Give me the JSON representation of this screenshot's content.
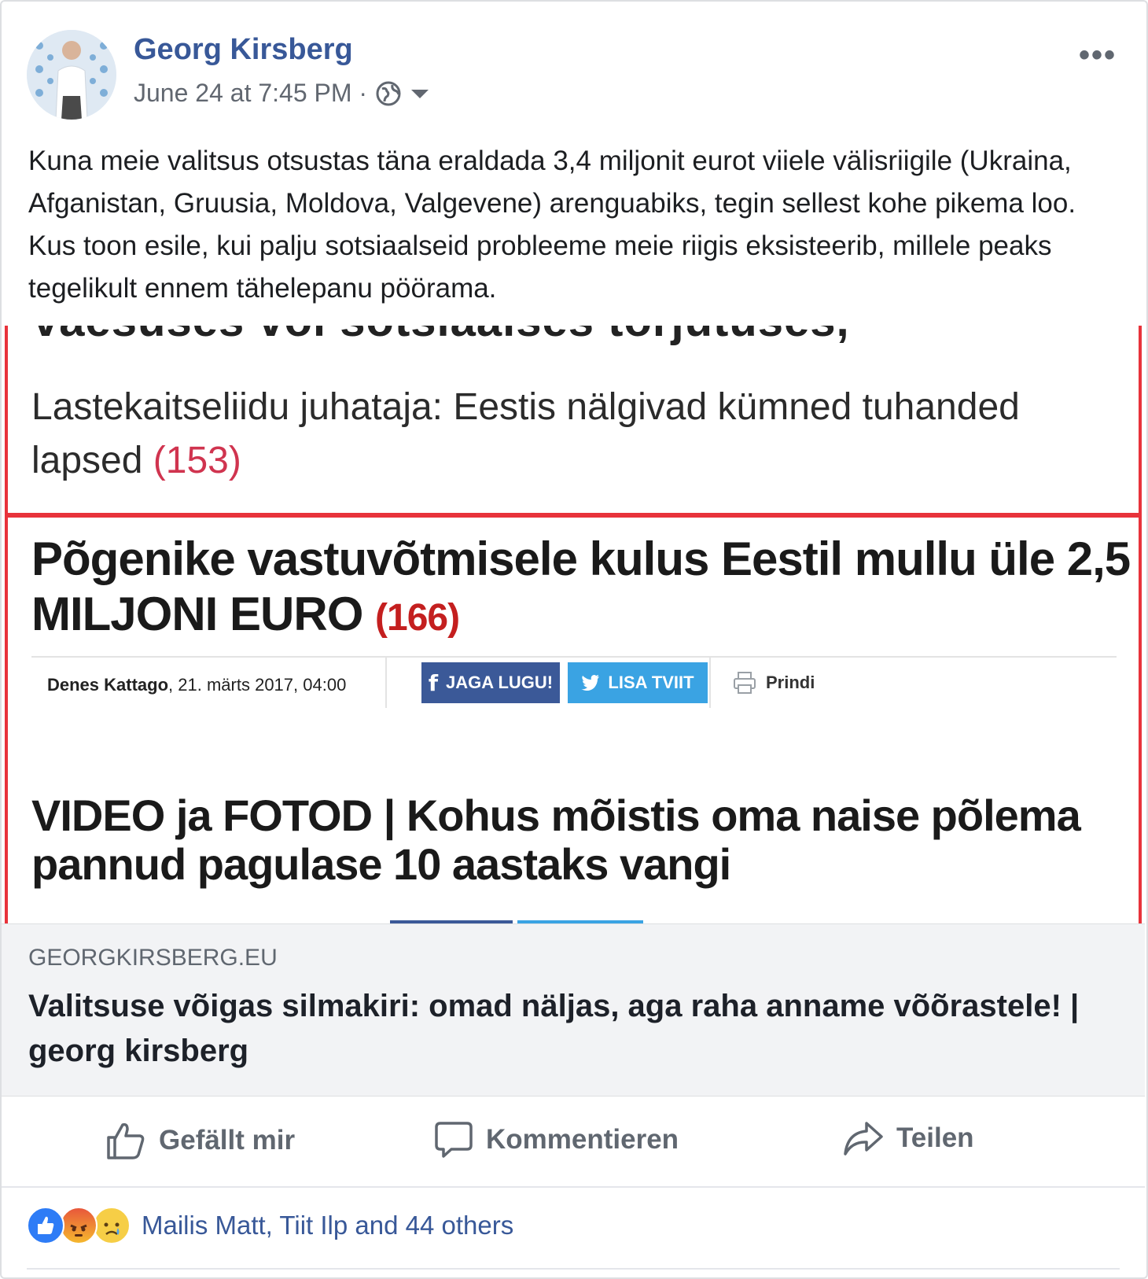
{
  "post": {
    "author": "Georg Kirsberg",
    "timestamp": "June 24 at 7:45 PM ·",
    "text": "Kuna meie valitsus otsustas täna eraldada 3,4 miljonit eurot viiele välisriigile (Ukraina, Afganistan, Gruusia, Moldova, Valgevene) arenguabiks, tegin sellest kohe pikema loo. Kus toon esile, kui palju sotsiaalseid probleeme meie riigis eksisteerib, millele peaks tegelikult ennem tähelepanu pöörama.",
    "privacy_icon": "globe-icon",
    "more_label": "•••"
  },
  "screenshot": {
    "cut_headline": "vaesuses või sotsiaalses tõrjutuses,",
    "headline1": "Lastekaitseliidu juhataja: Eestis nälgivad kümned tuhanded lapsed",
    "headline1_count": "(153)",
    "headline2": "Põgenike vastuvõtmisele kulus Eestil mullu üle 2,5 MILJONI EURO",
    "headline2_count": "(166)",
    "byline_author": "Denes Kattago",
    "byline_date": ", 21. märts 2017, 04:00",
    "share_fb": "JAGA LUGU!",
    "share_tw": "LISA TVIIT",
    "print": "Prindi",
    "headline3": "VIDEO ja FOTOD | Kohus mõistis oma naise põlema pannud pagulase 10 aastaks vangi",
    "colors": {
      "red_frame": "#e8333b",
      "fb_blue": "#3b5998",
      "tw_blue": "#3aa3e3"
    }
  },
  "link_preview": {
    "domain": "GEORGKIRSBERG.EU",
    "title": "Valitsuse võigas silmakiri: omad näljas, aga raha anname võõrastele! | georg kirsberg"
  },
  "actions": {
    "like": "Gefällt mir",
    "comment": "Kommentieren",
    "share": "Teilen"
  },
  "reactions": {
    "summary": "Mailis Matt, Tiit Ilp and 44 others",
    "icons": [
      "like-icon",
      "angry-icon",
      "sad-icon"
    ]
  },
  "theme": {
    "link_blue": "#385898",
    "muted": "#606770"
  }
}
